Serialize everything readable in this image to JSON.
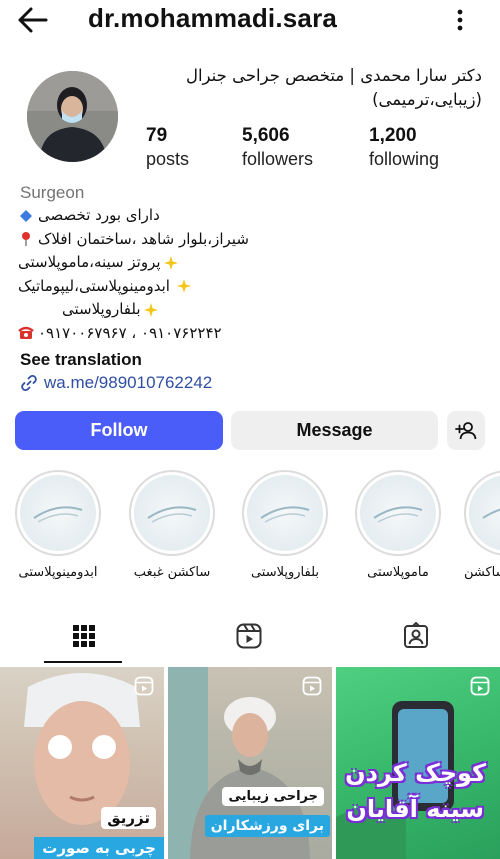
{
  "header": {
    "username": "dr.mohammadi.sara"
  },
  "profile": {
    "full_name": "دکتر سارا محمدی | متخصص جراحی جنرال (زیبایی،ترمیمی)",
    "stats": [
      {
        "value": "79",
        "label": "posts"
      },
      {
        "value": "5,606",
        "label": "followers"
      },
      {
        "value": "1,200",
        "label": "following"
      }
    ],
    "category": "Surgeon",
    "bio": [
      {
        "icon": "blue-diamond-icon",
        "text": "دارای بورد تخصصی"
      },
      {
        "icon": "red-pin-icon",
        "text": "شیراز،بلوار شاهد ،ساختمان افلاک"
      },
      {
        "icon": "sparkle-icon",
        "text": "پروتز سینه،ماموپلاستی"
      },
      {
        "icon": "sparkle-icon",
        "text": "ابدومینوپلاستی،لیپوماتیک"
      },
      {
        "icon": "sparkle-icon",
        "text": "بلفاروپلاستی"
      },
      {
        "icon": "telephone-icon",
        "text": "۰۹۱۰۷۶۲۲۴۲ ، ۰۹۱۷۰۰۶۷۹۶۷"
      }
    ],
    "see_translation": "See translation",
    "link": "wa.me/989010762242"
  },
  "actions": {
    "follow": "Follow",
    "message": "Message"
  },
  "highlights": [
    {
      "label": "ابدومینوپلاستی"
    },
    {
      "label": "ساکشن غبغب"
    },
    {
      "label": "بلفاروپلاستی"
    },
    {
      "label": "ماموپلاستی"
    },
    {
      "label": "ساکشن"
    }
  ],
  "tabs": [
    {
      "icon": "grid-icon",
      "active": true
    },
    {
      "icon": "reels-icon",
      "active": false
    },
    {
      "icon": "tagged-icon",
      "active": false
    }
  ],
  "posts": [
    {
      "captions": [
        "تزریق",
        "چربی به صورت"
      ]
    },
    {
      "captions": [
        "جراحی زیبایی",
        "برای ورزشکاران"
      ]
    },
    {
      "captions": [
        "کوچک کردن",
        "سینه آقایان"
      ]
    }
  ],
  "colors": {
    "follow_button": "#4a5df9",
    "link": "#2f4fa3",
    "secondary_button": "#efefef",
    "caption_blue": "#29a7e1",
    "caption_purple": "#7a2fd6"
  }
}
